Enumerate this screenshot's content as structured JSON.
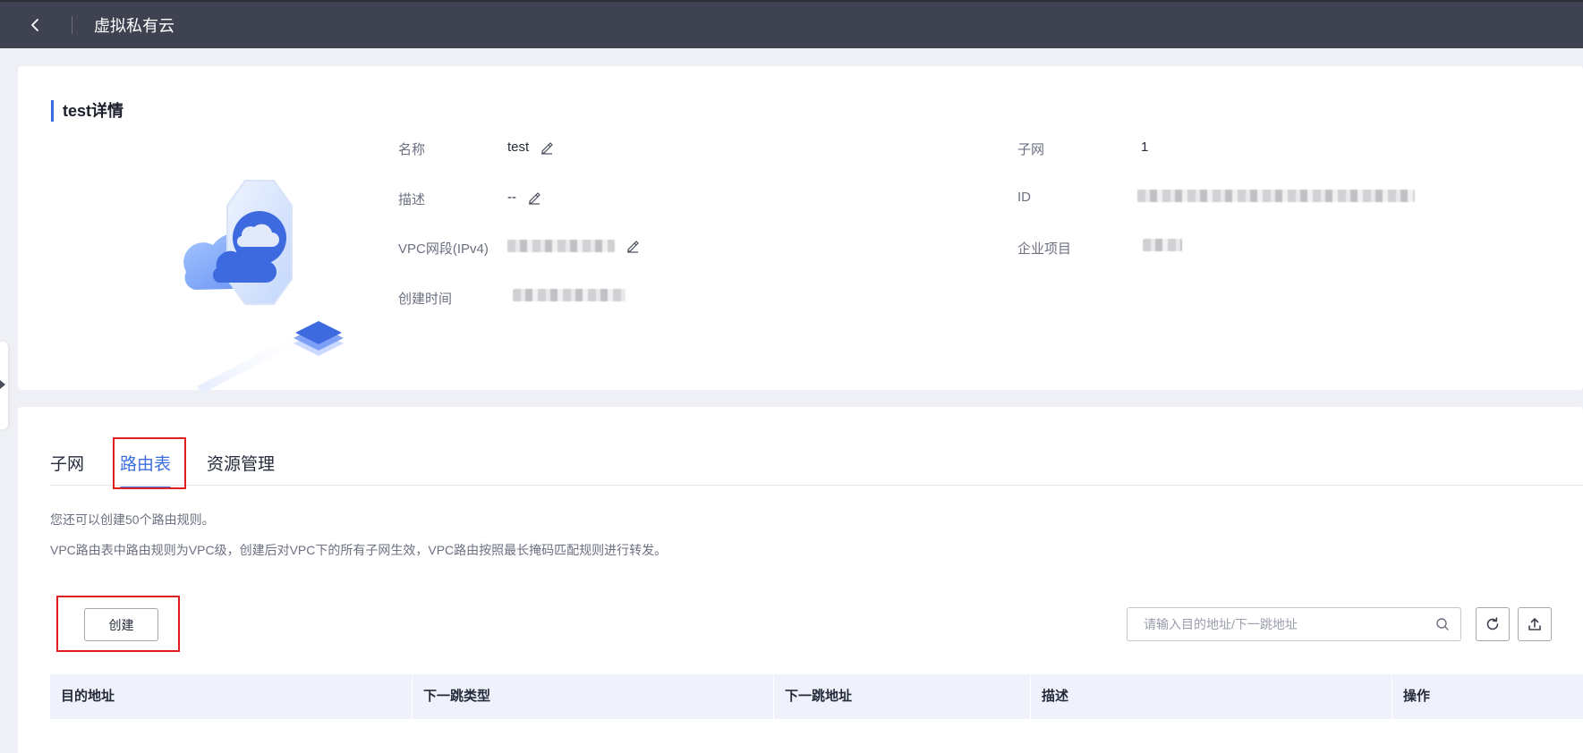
{
  "header": {
    "title": "虚拟私有云"
  },
  "detail": {
    "title": "test详情",
    "left_fields": [
      {
        "label": "名称",
        "value": "test"
      },
      {
        "label": "描述",
        "value": "--"
      },
      {
        "label": "VPC网段(IPv4)",
        "value": ""
      },
      {
        "label": "创建时间",
        "value": ""
      }
    ],
    "right_fields": [
      {
        "label": "子网",
        "value": "1"
      },
      {
        "label": "ID",
        "value": ""
      },
      {
        "label": "企业项目",
        "value": ""
      }
    ]
  },
  "tabs": [
    {
      "label": "子网",
      "active": false
    },
    {
      "label": "路由表",
      "active": true
    },
    {
      "label": "资源管理",
      "active": false
    }
  ],
  "notes": [
    "您还可以创建50个路由规则。",
    "VPC路由表中路由规则为VPC级，创建后对VPC下的所有子网生效，VPC路由按照最长掩码匹配规则进行转发。"
  ],
  "toolbar": {
    "create_label": "创建",
    "search_placeholder": "请输入目的地址/下一跳地址"
  },
  "table": {
    "columns": [
      "目的地址",
      "下一跳类型",
      "下一跳地址",
      "描述",
      "操作"
    ]
  },
  "colors": {
    "accent": "#3b6fe0",
    "highlight": "#e02020",
    "topbar": "#3f4250"
  }
}
